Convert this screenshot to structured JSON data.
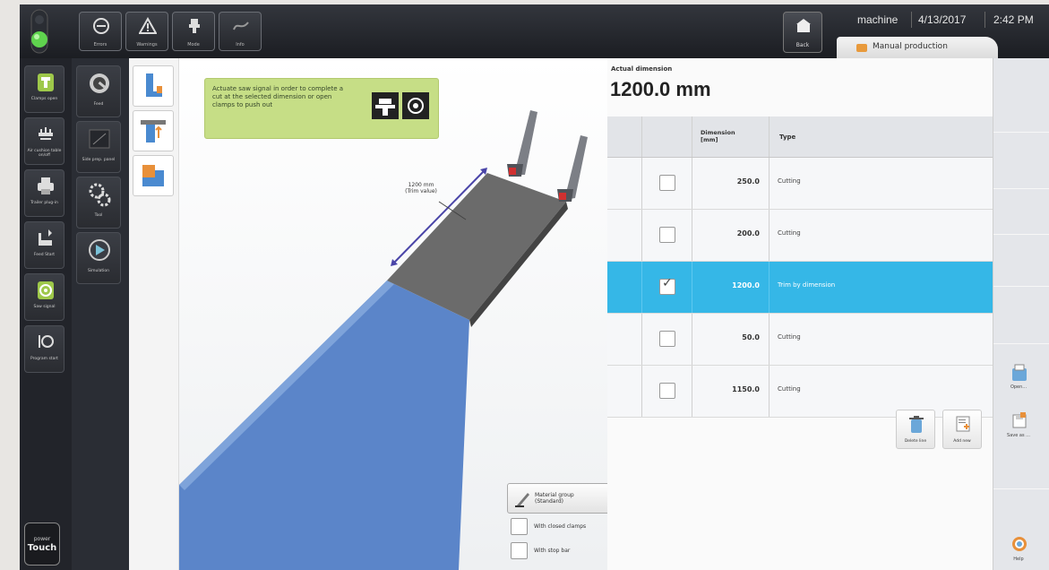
{
  "header": {
    "toolbar": [
      {
        "label": "Errors",
        "icon": "minus-circle-icon"
      },
      {
        "label": "Warnings",
        "icon": "warning-triangle-icon"
      },
      {
        "label": "Mode",
        "icon": "machine-icon"
      },
      {
        "label": "Info",
        "icon": "graph-icon"
      }
    ],
    "back_label": "Back",
    "machine": "machine",
    "date": "4/13/2017",
    "time": "2:42 PM",
    "production_tab": "Manual production"
  },
  "sidebar_primary": {
    "items": [
      {
        "label": "Clamps open",
        "icon": "clamp-icon"
      },
      {
        "label": "Air cushion table on/off",
        "icon": "air-table-icon"
      },
      {
        "label": "Trailer plug-in",
        "icon": "printer-icon"
      },
      {
        "label": "Feed Start",
        "icon": "feed-start-icon"
      },
      {
        "label": "Saw signal",
        "icon": "saw-signal-icon"
      },
      {
        "label": "Program start",
        "icon": "program-start-icon"
      }
    ],
    "brand_top": "power",
    "brand_bottom": "Touch"
  },
  "sidebar_secondary": {
    "items": [
      {
        "label": "Feed",
        "icon": "magnifier-icon"
      },
      {
        "label": "Side prep. panel",
        "icon": "panel-icon"
      },
      {
        "label": "Tool",
        "icon": "gears-icon"
      },
      {
        "label": "Simulation",
        "icon": "simulation-icon"
      }
    ]
  },
  "workspace": {
    "hint": "Actuate saw signal in order to complete a cut at the selected dimension or open clamps to push out",
    "dimension_label_line1": "1200 mm",
    "dimension_label_line2": "(Trim value)",
    "material_group_line1": "Material group",
    "material_group_line2": "(Standard)",
    "with_closed_clamps": "With closed clamps",
    "with_stop_bar": "With stop bar"
  },
  "dimension_panel": {
    "actual_label": "Actual dimension",
    "actual_value": "1200.0 mm",
    "columns": {
      "dimension_line1": "Dimension",
      "dimension_line2": "[mm]",
      "type": "Type"
    },
    "rows": [
      {
        "dimension": "250.0",
        "type": "Cutting",
        "checked": false,
        "selected": false
      },
      {
        "dimension": "200.0",
        "type": "Cutting",
        "checked": false,
        "selected": false
      },
      {
        "dimension": "1200.0",
        "type": "Trim by dimension",
        "checked": true,
        "selected": true
      },
      {
        "dimension": "50.0",
        "type": "Cutting",
        "checked": false,
        "selected": false
      },
      {
        "dimension": "1150.0",
        "type": "Cutting",
        "checked": false,
        "selected": false
      }
    ],
    "delete_label": "Delete line",
    "add_label": "Add new"
  },
  "right_strip": {
    "open_label": "Open...",
    "save_label": "Save as ...",
    "help_label": "Help"
  },
  "colors": {
    "selection": "#35b7e7",
    "hint_bg": "#c6de86",
    "workpiece_blue": "#5b85c9",
    "workpiece_grey": "#6b6b6b",
    "indicator_green": "#5fd34e"
  }
}
